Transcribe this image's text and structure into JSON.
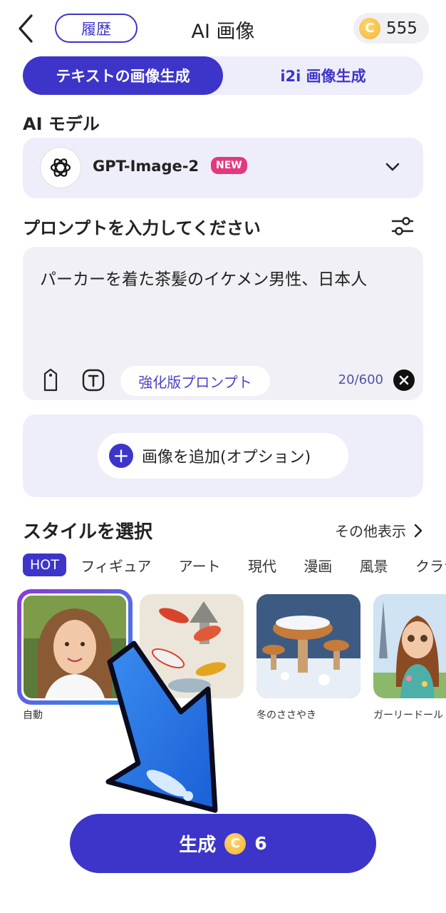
{
  "header": {
    "history_label": "履歴",
    "title": "AI 画像",
    "coin_symbol": "C",
    "coin_balance": "555"
  },
  "mode_tabs": [
    {
      "label": "テキストの画像生成",
      "active": true
    },
    {
      "label": "i2i 画像生成",
      "active": false
    }
  ],
  "model_section": {
    "label": "AI モデル",
    "selected_model": "GPT-Image-2",
    "badge": "NEW"
  },
  "prompt_section": {
    "label": "プロンプトを入力してください",
    "value": "パーカーを着た茶髪のイケメン男性、日本人",
    "enhance_label": "強化版プロンプト",
    "char_count": "20/600"
  },
  "add_image": {
    "label": "画像を追加(オプション)"
  },
  "style_section": {
    "label": "スタイルを選択",
    "more_label": "その他表示",
    "categories": [
      "HOT",
      "フィギュア",
      "アート",
      "現代",
      "漫画",
      "風景",
      "クラシ"
    ],
    "active_category": "HOT",
    "styles": [
      {
        "caption": "自動",
        "selected": true
      },
      {
        "caption": "",
        "selected": false
      },
      {
        "caption": "冬のささやき",
        "selected": false
      },
      {
        "caption": "ガーリードール",
        "selected": false
      }
    ]
  },
  "generate": {
    "label": "生成",
    "coin_symbol": "C",
    "cost": "6"
  },
  "colors": {
    "accent": "#3d35c9",
    "badge": "#e2397e",
    "panel": "#eeeefb",
    "coin": "#f3b43a"
  }
}
